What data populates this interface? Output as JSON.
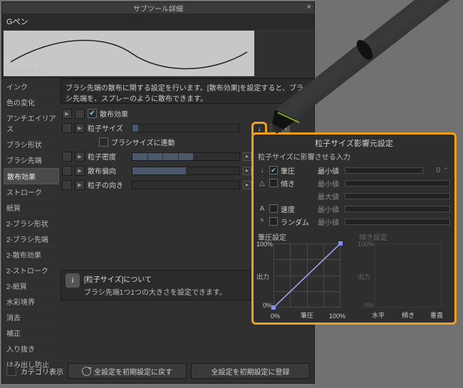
{
  "title": "サブツール詳細",
  "tool_name": "Gペン",
  "description": "ブラシ先端の散布に関する設定を行います。[散布効果]を設定すると、ブラシ先端を、スプレーのように散布できます。",
  "sidebar": {
    "items": [
      {
        "label": "ブラシサイズ"
      },
      {
        "label": "インク"
      },
      {
        "label": "色の変化"
      },
      {
        "label": "アンチエイリアス"
      },
      {
        "label": "ブラシ形状"
      },
      {
        "label": "ブラシ先端"
      },
      {
        "label": "散布効果"
      },
      {
        "label": "ストローク"
      },
      {
        "label": "紙質"
      },
      {
        "label": "2-ブラシ形状"
      },
      {
        "label": "2-ブラシ先端"
      },
      {
        "label": "2-散布効果"
      },
      {
        "label": "2-ストローク"
      },
      {
        "label": "2-紙質"
      },
      {
        "label": "水彩境界"
      },
      {
        "label": "消去"
      },
      {
        "label": "補正"
      },
      {
        "label": "入り抜き"
      },
      {
        "label": "はみ出し防止"
      }
    ],
    "active_index": 6
  },
  "rows": {
    "scatter": {
      "label": "散布効果",
      "checked": true
    },
    "psize": {
      "label": "粒子サイズ",
      "value": "0.20",
      "value_pct": 5
    },
    "linkbrush": {
      "label": "ブラシサイズに連動",
      "checked": false
    },
    "density": {
      "label": "粒子密度",
      "seg_on": 4,
      "seg_total": 7
    },
    "bias": {
      "label": "散布偏向",
      "value_pct": 50
    },
    "orient": {
      "label": "粒子の向き"
    }
  },
  "info": {
    "title": "[粒子サイズ]について",
    "body": "ブラシ先端1つ1つの大きさを設定できます。"
  },
  "bottom": {
    "cat": "カテゴリ表示",
    "reset": "全設定を初期設定に戻す",
    "save": "全設定を初期設定に登録"
  },
  "callout": {
    "title": "粒子サイズ影響元設定",
    "subtitle": "粒子サイズに影響させる入力",
    "items": [
      {
        "icon": "↓",
        "checked": true,
        "label": "筆圧",
        "param": "最小値",
        "enabled": true,
        "value": "0",
        "fill_pct": 0
      },
      {
        "icon": "△",
        "checked": false,
        "label": "傾き",
        "param": "最小値",
        "enabled": false
      },
      {
        "icon": "",
        "checked": null,
        "label": "",
        "param": "最大値",
        "enabled": false
      },
      {
        "icon": "A",
        "checked": false,
        "label": "速度",
        "param": "最小値",
        "enabled": false
      },
      {
        "icon": "ʰ",
        "checked": false,
        "label": "ランダム",
        "param": "最小値",
        "enabled": false
      }
    ],
    "graph1": {
      "title": "筆圧設定",
      "ylabel": "出力",
      "xlabel": "筆圧",
      "y_ticks": [
        "100%",
        "0%"
      ],
      "x_ticks": [
        "0%",
        "筆圧",
        "100%"
      ]
    },
    "graph2": {
      "title": "傾き設定",
      "ylabel": "出力",
      "y_ticks": [
        "100%",
        "0%"
      ],
      "x_ticks": [
        "水平",
        "傾き",
        "垂直"
      ]
    }
  },
  "chart_data": {
    "type": "line",
    "title": "筆圧設定",
    "xlabel": "筆圧",
    "ylabel": "出力",
    "x": [
      0,
      100
    ],
    "y": [
      0,
      100
    ],
    "xlim": [
      0,
      100
    ],
    "ylim": [
      0,
      100
    ]
  }
}
